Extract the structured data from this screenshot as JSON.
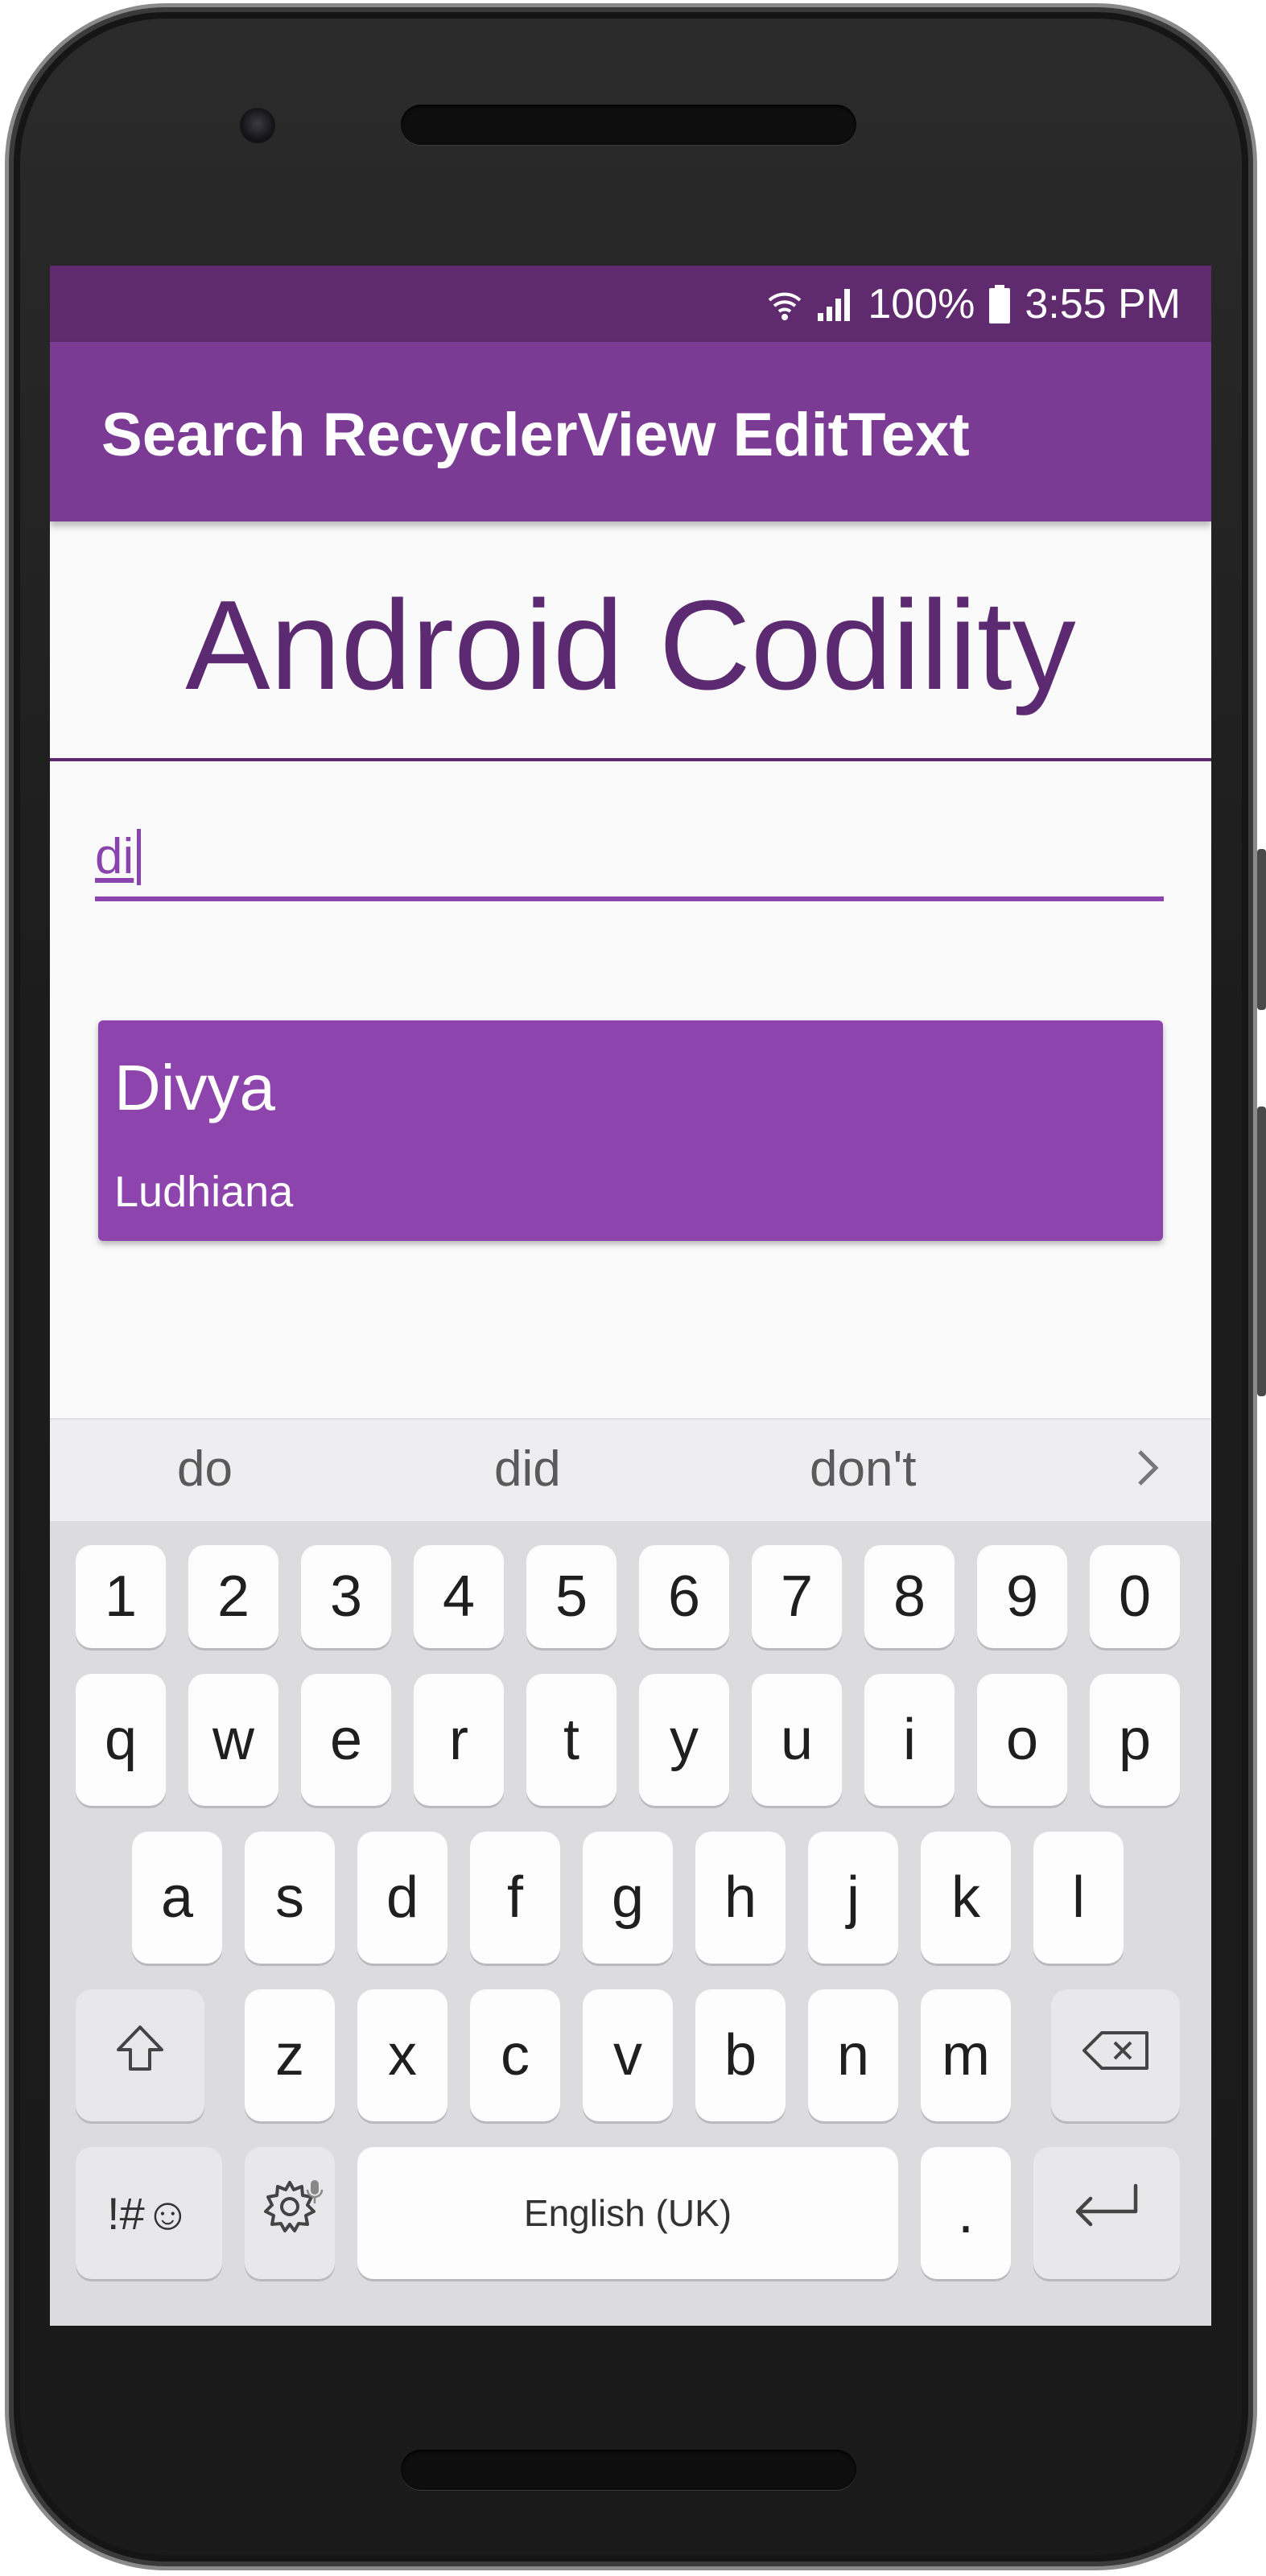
{
  "status_bar": {
    "battery": "100%",
    "time": "3:55 PM",
    "icons": [
      "wifi-icon",
      "signal-icon",
      "battery-icon"
    ]
  },
  "app_bar": {
    "title": "Search RecyclerView EditText"
  },
  "brand": {
    "text": "Android Codility"
  },
  "search": {
    "value": "di"
  },
  "results": [
    {
      "name": "Divya",
      "city": "Ludhiana"
    }
  ],
  "keyboard": {
    "suggestions": [
      "do",
      "did",
      "don't"
    ],
    "row_numbers": [
      "1",
      "2",
      "3",
      "4",
      "5",
      "6",
      "7",
      "8",
      "9",
      "0"
    ],
    "row_top": [
      "q",
      "w",
      "e",
      "r",
      "t",
      "y",
      "u",
      "i",
      "o",
      "p"
    ],
    "row_middle": [
      "a",
      "s",
      "d",
      "f",
      "g",
      "h",
      "j",
      "k",
      "l"
    ],
    "row_bottom": [
      "z",
      "x",
      "c",
      "v",
      "b",
      "n",
      "m"
    ],
    "symbols_label": "!#☺",
    "space_label": "English (UK)",
    "period_label": "."
  },
  "colors": {
    "status_bar": "#5f2b6e",
    "app_bar": "#7b3b94",
    "brand_text": "#5c2a71",
    "accent": "#8b44ad",
    "card": "#8e44ad",
    "keyboard_bg": "#dcdcdf"
  }
}
